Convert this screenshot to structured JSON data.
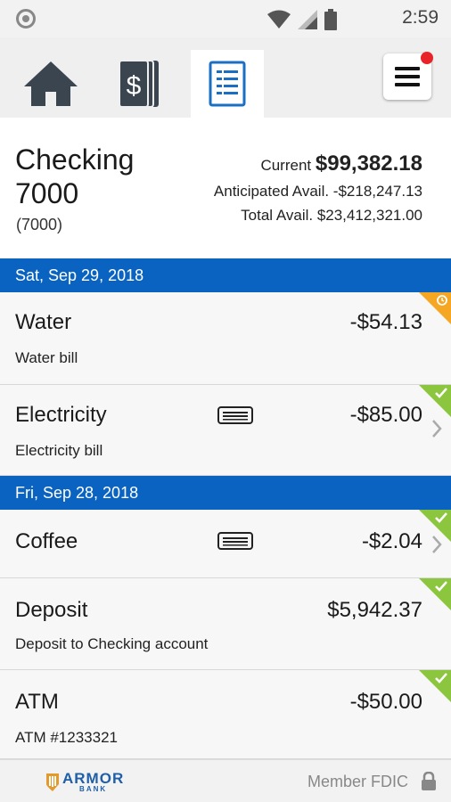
{
  "status_bar": {
    "time": "2:59"
  },
  "tabs": [
    {
      "name": "home",
      "active": false
    },
    {
      "name": "accounts",
      "active": false
    },
    {
      "name": "transactions",
      "active": true
    }
  ],
  "account": {
    "name": "Checking 7000",
    "sub": "(7000)",
    "current_label": "Current",
    "current_value": "$99,382.18",
    "anticipated": "Anticipated Avail. -$218,247.13",
    "total": "Total Avail. $23,412,321.00"
  },
  "groups": [
    {
      "date": "Sat, Sep 29, 2018",
      "transactions": [
        {
          "name": "Water",
          "desc": "Water bill",
          "amount": "-$54.13",
          "status": "pending",
          "card": false,
          "chevron": false
        },
        {
          "name": "Electricity",
          "desc": "Electricity bill",
          "amount": "-$85.00",
          "status": "cleared",
          "card": true,
          "chevron": true
        }
      ]
    },
    {
      "date": "Fri, Sep 28, 2018",
      "transactions": [
        {
          "name": "Coffee",
          "desc": "",
          "amount": "-$2.04",
          "status": "cleared",
          "card": true,
          "chevron": true
        },
        {
          "name": "Deposit",
          "desc": "Deposit to Checking account",
          "amount": "$5,942.37",
          "status": "cleared",
          "card": false,
          "chevron": false
        },
        {
          "name": "ATM",
          "desc": "ATM #1233321",
          "amount": "-$50.00",
          "status": "cleared",
          "card": false,
          "chevron": false
        }
      ]
    }
  ],
  "footer": {
    "logo_main": "ARMOR",
    "logo_sub": "BANK",
    "member": "Member FDIC"
  },
  "colors": {
    "header_blue": "#0a63c0",
    "cleared_green": "#8cc63f",
    "pending_orange": "#f5a623",
    "badge_red": "#e8232a"
  }
}
